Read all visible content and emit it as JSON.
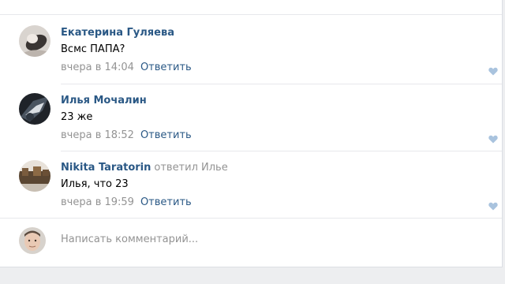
{
  "colors": {
    "link": "#2a5885",
    "meta": "#939393",
    "text": "#000000",
    "like": "#a9c3de"
  },
  "comments": [
    {
      "author": "Екатерина Гуляева",
      "reply_to": "",
      "text": "Всмс ПАПА?",
      "time": "вчера в 14:04",
      "reply_label": "Ответить",
      "like_icon": "heart-icon"
    },
    {
      "author": "Илья Мочалин",
      "reply_to": "",
      "text": "23 же",
      "time": "вчера в 18:52",
      "reply_label": "Ответить",
      "like_icon": "heart-icon"
    },
    {
      "author": "Nikita Taratorin",
      "reply_to": "ответил Илье",
      "text": "Илья, что 23",
      "time": "вчера в 19:59",
      "reply_label": "Ответить",
      "like_icon": "heart-icon"
    }
  ],
  "compose": {
    "placeholder": "Написать комментарий..."
  }
}
